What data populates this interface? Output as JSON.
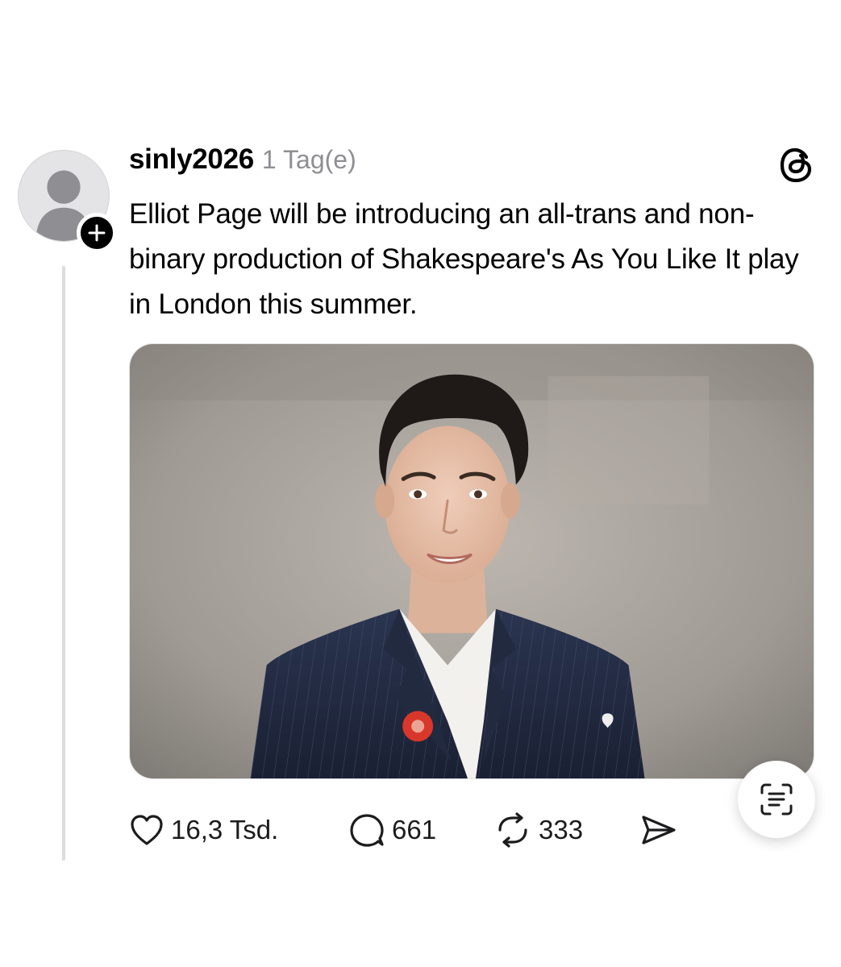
{
  "post": {
    "username": "sinly2026",
    "timestamp": "1 Tag(e)",
    "text": "Elliot Page will be introducing an all-trans and non-binary production of Shakespeare's As You Like It play in London this summer.",
    "image_alt": "Photo of Elliot Page smiling, wearing a dark pinstripe suit with a red pin and a white pin, over a white shirt"
  },
  "actions": {
    "likes": "16,3 Tsd.",
    "replies": "661",
    "reposts": "333"
  },
  "icons": {
    "avatar": "default-avatar-icon",
    "follow": "plus-icon",
    "brand": "threads-logo-icon",
    "like": "heart-icon",
    "reply": "speech-bubble-icon",
    "repost": "repost-icon",
    "share": "send-icon",
    "scan": "text-scan-icon"
  },
  "colors": {
    "text": "#000000",
    "muted": "#8e8e93",
    "thread_line": "#dcdcdc",
    "avatar_bg": "#e4e4e6"
  }
}
